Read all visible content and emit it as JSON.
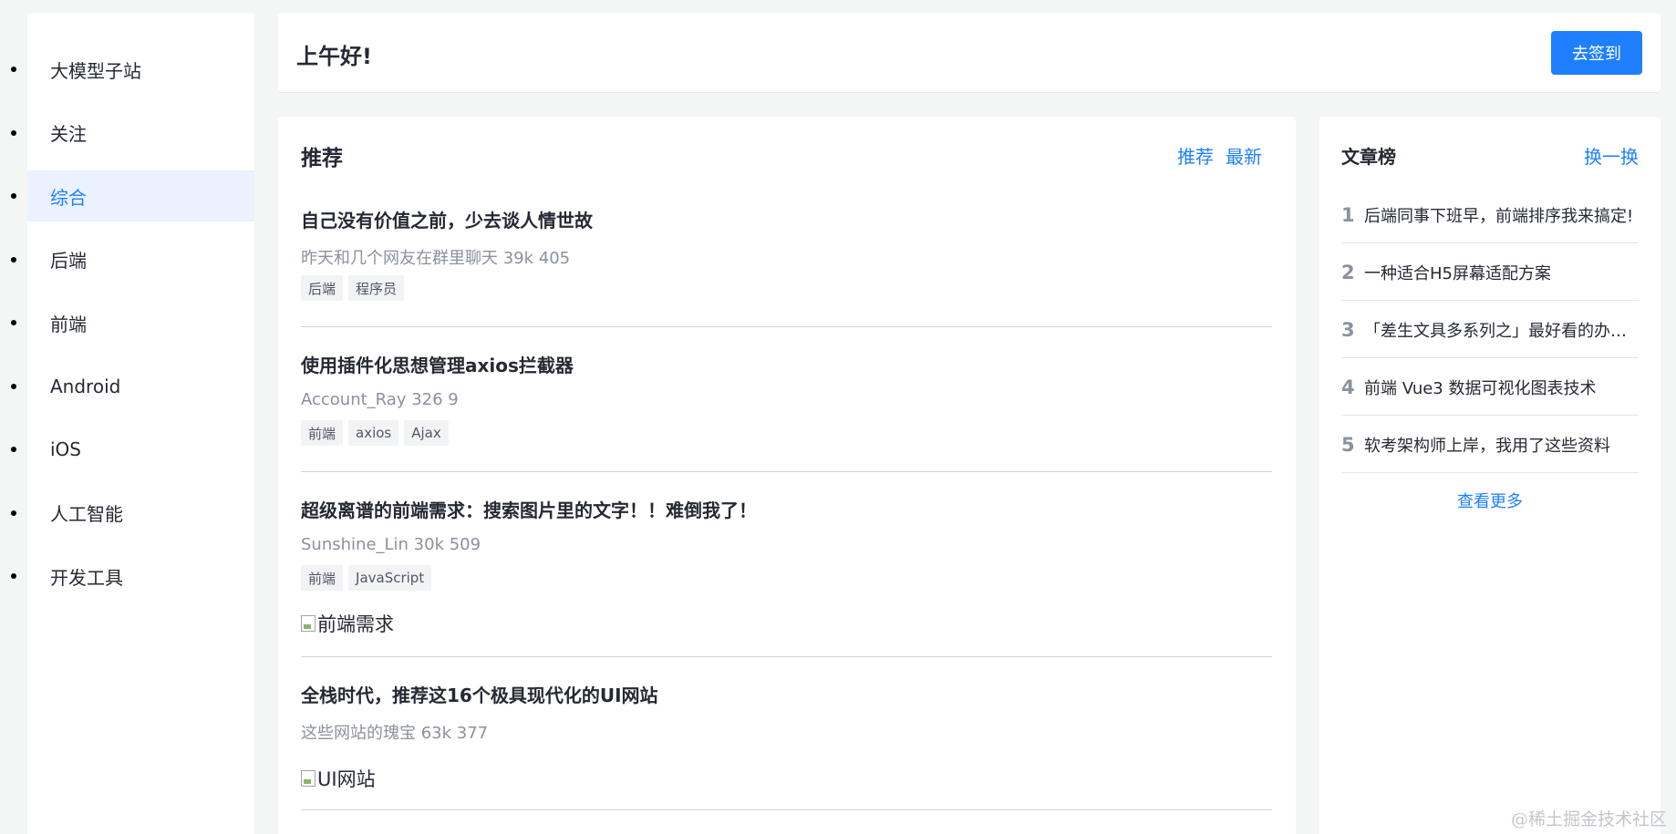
{
  "sidebar": {
    "items": [
      {
        "label": "大模型子站"
      },
      {
        "label": "关注"
      },
      {
        "label": "综合",
        "active": true
      },
      {
        "label": "后端"
      },
      {
        "label": "前端"
      },
      {
        "label": "Android"
      },
      {
        "label": "iOS"
      },
      {
        "label": "人工智能"
      },
      {
        "label": "开发工具"
      }
    ]
  },
  "header": {
    "greeting": "上午好!",
    "checkin_label": "去签到"
  },
  "feed": {
    "title": "推荐",
    "tabs": [
      "推荐",
      "最新"
    ],
    "articles": [
      {
        "title": "自己没有价值之前，少去谈人情世故",
        "meta": "昨天和几个网友在群里聊天 39k 405",
        "tags": [
          "后端",
          "程序员"
        ]
      },
      {
        "title": "使用插件化思想管理axios拦截器",
        "meta": "Account_Ray 326 9",
        "tags": [
          "前端",
          "axios",
          "Ajax"
        ]
      },
      {
        "title": "超级离谱的前端需求：搜索图片里的文字！！难倒我了！",
        "meta": "Sunshine_Lin 30k 509",
        "tags": [
          "前端",
          "JavaScript"
        ],
        "image_alt": "前端需求"
      },
      {
        "title": "全栈时代，推荐这16个极具现代化的UI网站",
        "meta": "这些网站的瑰宝 63k 377",
        "tags": [],
        "image_alt": "UI网站"
      }
    ]
  },
  "rank": {
    "title": "文章榜",
    "refresh_label": "换一换",
    "items": [
      {
        "num": "1",
        "text": "后端同事下班早，前端排序我来搞定!"
      },
      {
        "num": "2",
        "text": "一种适合H5屏幕适配方案"
      },
      {
        "num": "3",
        "text": "「差生文具多系列之」最好看的办公软件"
      },
      {
        "num": "4",
        "text": "前端 Vue3 数据可视化图表技术"
      },
      {
        "num": "5",
        "text": "软考架构师上岸，我用了这些资料"
      }
    ],
    "more_label": "查看更多"
  },
  "watermark": "@稀土掘金技术社区",
  "colors": {
    "accent": "#1e80ff",
    "active_bg": "#eaf2ff",
    "muted": "#8a919f"
  }
}
